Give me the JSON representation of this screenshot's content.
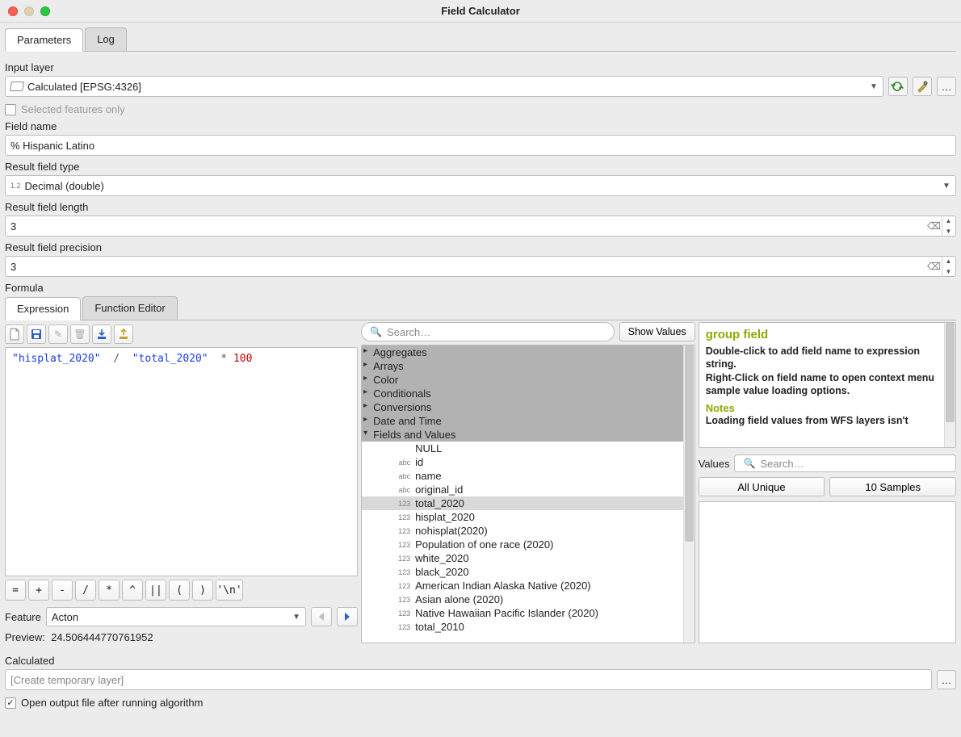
{
  "window": {
    "title": "Field Calculator"
  },
  "tabs_main": {
    "parameters": "Parameters",
    "log": "Log"
  },
  "input_layer": {
    "label": "Input layer",
    "value": "Calculated [EPSG:4326]",
    "selected_only": "Selected features only"
  },
  "field_name": {
    "label": "Field name",
    "value": "% Hispanic Latino"
  },
  "field_type": {
    "label": "Result field type",
    "value": "Decimal (double)",
    "prefix": "1.2"
  },
  "field_length": {
    "label": "Result field length",
    "value": "3"
  },
  "field_precision": {
    "label": "Result field precision",
    "value": "3"
  },
  "formula": {
    "label": "Formula",
    "tabs": {
      "expression": "Expression",
      "function_editor": "Function Editor"
    },
    "code_parts": {
      "s1": "\"hisplat_2020\"",
      "slash": "/",
      "s2": "\"total_2020\"",
      "star": "*",
      "num": "100"
    },
    "ops": [
      "=",
      "+",
      "-",
      "/",
      "*",
      "^",
      "||",
      "(",
      ")",
      "'\\n'"
    ],
    "feature_label": "Feature",
    "feature_value": "Acton",
    "preview_label": "Preview:",
    "preview_value": "24.506444770761952"
  },
  "search": {
    "placeholder": "Search…",
    "show_values": "Show Values"
  },
  "tree": {
    "groups": [
      "Aggregates",
      "Arrays",
      "Color",
      "Conditionals",
      "Conversions",
      "Date and Time",
      "Fields and Values"
    ],
    "fields": [
      {
        "type": "",
        "name": "NULL"
      },
      {
        "type": "abc",
        "name": "id"
      },
      {
        "type": "abc",
        "name": "name"
      },
      {
        "type": "abc",
        "name": "original_id"
      },
      {
        "type": "123",
        "name": "total_2020",
        "selected": true
      },
      {
        "type": "123",
        "name": "hisplat_2020"
      },
      {
        "type": "123",
        "name": "nohisplat(2020)"
      },
      {
        "type": "123",
        "name": "Population of one race (2020)"
      },
      {
        "type": "123",
        "name": "white_2020"
      },
      {
        "type": "123",
        "name": "black_2020"
      },
      {
        "type": "123",
        "name": "American Indian Alaska Native (2020)"
      },
      {
        "type": "123",
        "name": "Asian alone (2020)"
      },
      {
        "type": "123",
        "name": "Native Hawaiian Pacific Islander (2020)"
      },
      {
        "type": "123",
        "name": "total_2010"
      }
    ]
  },
  "help": {
    "title": "group field",
    "body1": "Double-click to add field name to expression string.",
    "body2": "Right-Click on field name to open context menu sample value loading options.",
    "notes": "Notes",
    "body3": "Loading field values from WFS layers isn't"
  },
  "values": {
    "label": "Values",
    "search_placeholder": "Search…",
    "all_unique": "All Unique",
    "samples": "10 Samples"
  },
  "output": {
    "label": "Calculated",
    "placeholder": "[Create temporary layer]",
    "open_after": "Open output file after running algorithm"
  }
}
